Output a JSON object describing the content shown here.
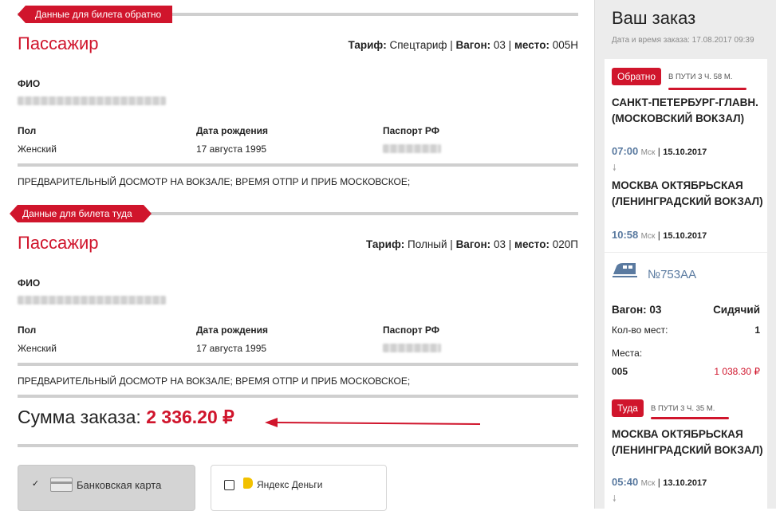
{
  "return_section": {
    "ribbon": "Данные для билета обратно",
    "passenger_title": "Пассажир",
    "tariff_label": "Тариф:",
    "tariff_value": "Спецтариф",
    "car_label": "Вагон:",
    "car_value": "03",
    "seat_label": "место:",
    "seat_value": "005Н",
    "fio_label": "ФИО",
    "gender_label": "Пол",
    "gender_value": "Женский",
    "dob_label": "Дата рождения",
    "dob_value": "17 августа 1995",
    "passport_label": "Паспорт РФ",
    "note": "ПРЕДВАРИТЕЛЬНЫЙ ДОСМОТР НА ВОКЗАЛЕ; ВРЕМЯ ОТПР И ПРИБ МОСКОВСКОЕ;"
  },
  "forward_section": {
    "ribbon": "Данные для билета туда",
    "passenger_title": "Пассажир",
    "tariff_label": "Тариф:",
    "tariff_value": "Полный",
    "car_label": "Вагон:",
    "car_value": "03",
    "seat_label": "место:",
    "seat_value": "020П",
    "fio_label": "ФИО",
    "gender_label": "Пол",
    "gender_value": "Женский",
    "dob_label": "Дата рождения",
    "dob_value": "17 августа 1995",
    "passport_label": "Паспорт РФ",
    "note": "ПРЕДВАРИТЕЛЬНЫЙ ДОСМОТР НА ВОКЗАЛЕ; ВРЕМЯ ОТПР И ПРИБ МОСКОВСКОЕ;"
  },
  "summary": {
    "label": "Сумма заказа:",
    "amount": "2 336.20 ₽"
  },
  "payment": {
    "card_label": "Банковская карта",
    "card_checked": "✓",
    "yandex_label": "Яндекс Деньги"
  },
  "sidebar": {
    "title": "Ваш заказ",
    "order_date": "Дата и время заказа: 17.08.2017 09:39",
    "back": {
      "tag": "Обратно",
      "duration": "В ПУТИ 3 Ч. 58 М.",
      "from_station": "САНКТ-ПЕТЕРБУРГ-ГЛАВН. (МОСКОВСКИЙ ВОКЗАЛ)",
      "dep_time": "07:00",
      "tz": "Мск",
      "dep_date": "15.10.2017",
      "to_station": "МОСКВА ОКТЯБРЬСКАЯ (ЛЕНИНГРАДСКИЙ ВОКЗАЛ)",
      "arr_time": "10:58",
      "arr_date": "15.10.2017",
      "train_number": "№753АА",
      "car_label": "Вагон: 03",
      "car_type": "Сидячий",
      "seats_count_label": "Кол-во мест:",
      "seats_count": "1",
      "seats_label": "Места:",
      "seat": "005",
      "price": "1 038.30 ₽"
    },
    "forward": {
      "tag": "Туда",
      "duration": "В ПУТИ 3 Ч. 35 М.",
      "from_station": "МОСКВА ОКТЯБРЬСКАЯ (ЛЕНИНГРАДСКИЙ ВОКЗАЛ)",
      "dep_time": "05:40",
      "tz": "Мск",
      "dep_date": "13.10.2017"
    }
  },
  "colors": {
    "accent": "#d0152c",
    "link_blue": "#5a7aa0",
    "sidebar_bg": "#ececec"
  }
}
